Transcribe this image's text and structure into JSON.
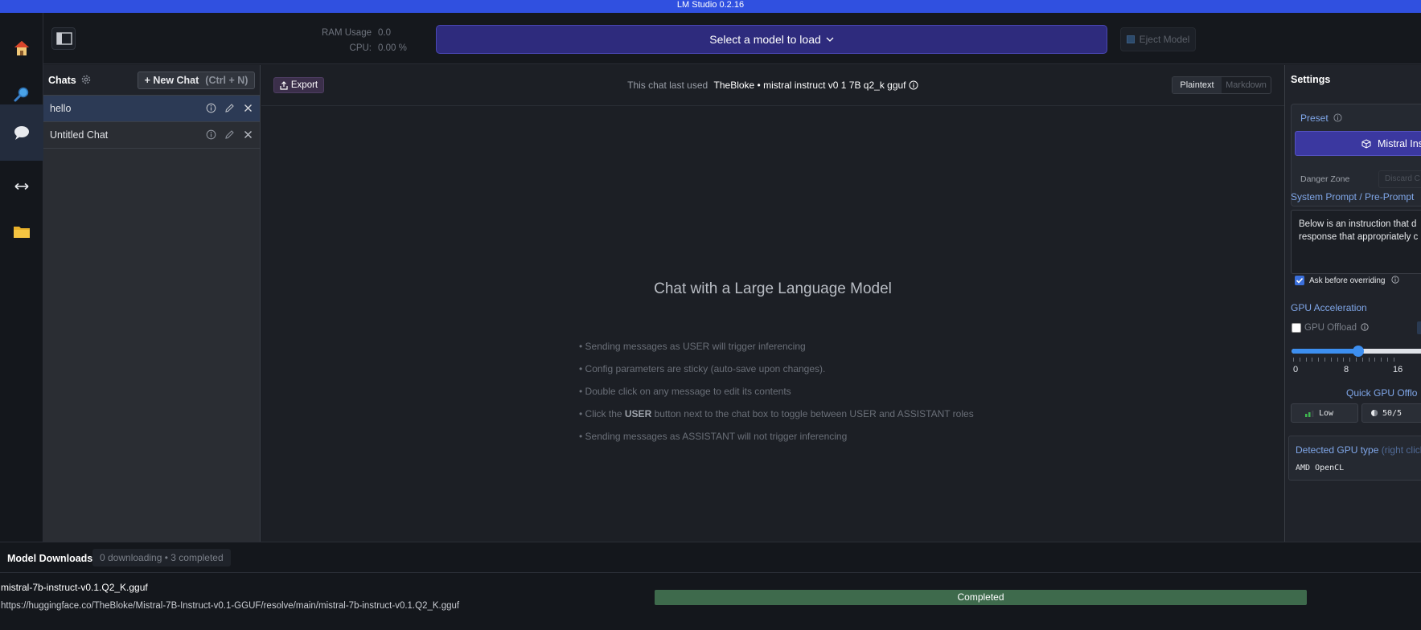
{
  "window": {
    "title": "LM Studio 0.2.16"
  },
  "rail": {
    "items": [
      {
        "icon": "home-icon"
      },
      {
        "icon": "search-icon"
      },
      {
        "icon": "chat-icon",
        "active": true
      },
      {
        "icon": "arrows-horizontal-icon"
      },
      {
        "icon": "folder-icon"
      }
    ]
  },
  "topbar": {
    "ram_label": "RAM Usage",
    "ram_value": "0.0",
    "cpu_label": "CPU:",
    "cpu_value": "0.00 %",
    "model_select_label": "Select a model to load",
    "eject_label": "Eject Model"
  },
  "chats": {
    "title": "Chats",
    "new_chat_label": "+ New Chat",
    "new_chat_shortcut": "(Ctrl + N)",
    "items": [
      {
        "name": "hello",
        "active": true
      },
      {
        "name": "Untitled Chat",
        "active": false
      }
    ]
  },
  "main": {
    "export_label": "Export",
    "last_used_prefix": "This chat last used",
    "last_used_model": "TheBloke • mistral instruct v0 1 7B q2_k gguf",
    "format_options": [
      "Plaintext",
      "Markdown"
    ],
    "format_selected": "Plaintext",
    "heading": "Chat with a Large Language Model",
    "tips": [
      "• Sending messages as USER will trigger inferencing",
      "• Config parameters are sticky (auto-save upon changes).",
      "• Double click on any message to edit its contents",
      "• Sending messages as ASSISTANT will not trigger inferencing"
    ],
    "tip_user_prefix": "• Click the ",
    "tip_user_bold": "USER",
    "tip_user_suffix": " button next to the chat box to toggle between USER and ASSISTANT roles"
  },
  "settings": {
    "title": "Settings",
    "preset_label": "Preset",
    "preset_value": "Mistral Ins",
    "danger_zone_label": "Danger Zone",
    "discard_label": "Discard C",
    "system_prompt_label": "System Prompt / Pre-Prompt",
    "system_prompt_line1": "Below is an instruction that d",
    "system_prompt_line2": "response that appropriately c",
    "ask_override_label": "Ask before overriding",
    "ask_override_checked": true,
    "gpu_accel_label": "GPU Acceleration",
    "gpu_offload_label": "GPU Offload",
    "gpu_offload_checked": false,
    "slider_fraction": 0.49,
    "slider_ticks": [
      "0",
      "8",
      "16"
    ],
    "quick_offload_label": "Quick GPU Offlo",
    "quick_low_label": "Low",
    "quick_half_label": "50/5",
    "detected_gpu_label": "Detected GPU type",
    "detected_gpu_hint": "(right click",
    "detected_gpu_value": "AMD OpenCL"
  },
  "downloads": {
    "title": "Model Downloads",
    "status": "0 downloading • 3 completed",
    "items": [
      {
        "file": "mistral-7b-instruct-v0.1.Q2_K.gguf",
        "url": "https://huggingface.co/TheBloke/Mistral-7B-Instruct-v0.1-GGUF/resolve/main/mistral-7b-instruct-v0.1.Q2_K.gguf",
        "progress": 1.0,
        "status": "Completed"
      }
    ]
  },
  "colors": {
    "titlebar": "#3050e0",
    "accent": "#3b38a0",
    "link": "#7fa6e8",
    "completed": "#3e6a4c"
  }
}
